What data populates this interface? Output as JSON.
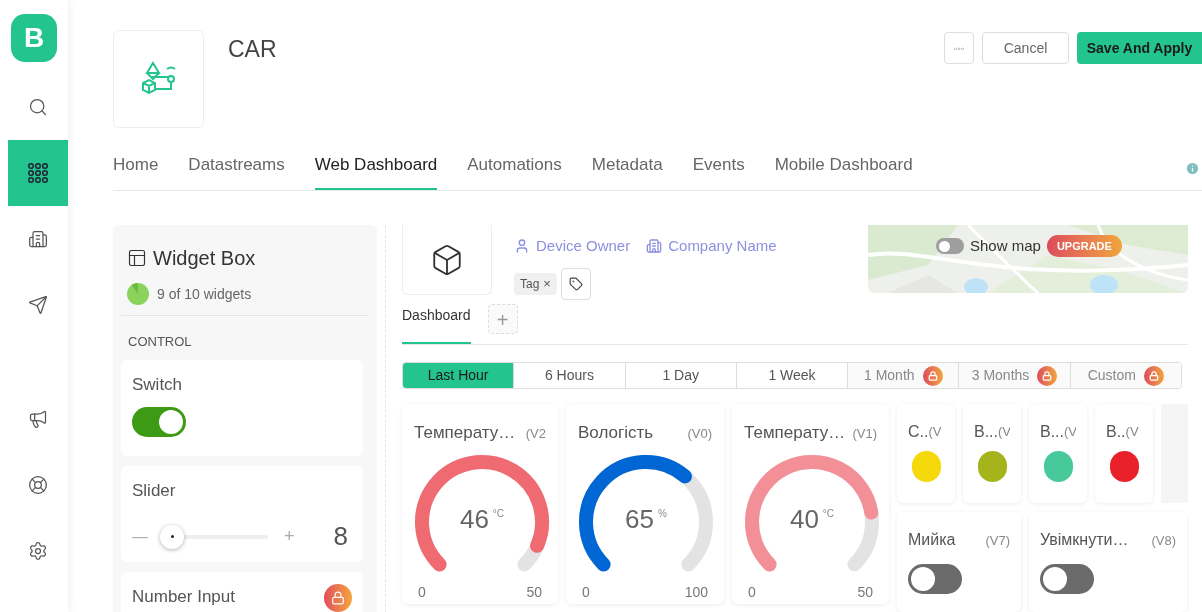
{
  "sidebar": {
    "logo": "B",
    "items": [
      {
        "selected": false
      },
      {
        "selected": true
      },
      {
        "selected": false
      },
      {
        "selected": false
      },
      {
        "selected": false
      },
      {
        "selected": false
      },
      {
        "selected": false
      }
    ]
  },
  "header": {
    "title": "CAR",
    "more_button": "◦◦◦",
    "cancel_button": "Cancel",
    "save_button": "Save And Apply"
  },
  "tabs": [
    {
      "label": "Home",
      "selected": false
    },
    {
      "label": "Datastreams",
      "selected": false
    },
    {
      "label": "Web Dashboard",
      "selected": true
    },
    {
      "label": "Automations",
      "selected": false
    },
    {
      "label": "Metadata",
      "selected": false
    },
    {
      "label": "Events",
      "selected": false
    },
    {
      "label": "Mobile Dashboard",
      "selected": false
    }
  ],
  "widget_box": {
    "title": "Widget Box",
    "count": "9 of 10 widgets",
    "section": "CONTROL",
    "widgets": [
      {
        "kind": "switch",
        "title": "Switch",
        "on": true
      },
      {
        "kind": "slider",
        "title": "Slider",
        "minus": "—",
        "plus": "+",
        "reading": "8"
      },
      {
        "kind": "locked",
        "title": "Number Input"
      }
    ]
  },
  "device": {
    "owner": "Device Owner",
    "company": "Company Name",
    "tags": [
      {
        "label": "Tag",
        "remove": "×"
      }
    ],
    "map": {
      "toggle_label": "Show map",
      "on": false,
      "badge": "UPGRADE"
    }
  },
  "dashboard_tabs": [
    {
      "label": "Dashboard",
      "selected": true
    }
  ],
  "add_tab": "+",
  "time_ranges": [
    {
      "label": "Last Hour",
      "selected": true,
      "locked": false
    },
    {
      "label": "6 Hours",
      "selected": false,
      "locked": false
    },
    {
      "label": "1 Day",
      "selected": false,
      "locked": false
    },
    {
      "label": "1 Week",
      "selected": false,
      "locked": false
    },
    {
      "label": "1 Month",
      "selected": false,
      "locked": true
    },
    {
      "label": "3 Months",
      "selected": false,
      "locked": true
    },
    {
      "label": "Custom",
      "selected": false,
      "locked": true
    }
  ],
  "gauges": [
    {
      "title": "Температу…",
      "pin": "(V2",
      "value": "46",
      "unit": "°C",
      "min": "0",
      "max": "50",
      "color": "#f06a72"
    },
    {
      "title": "Вологість",
      "pin": "(V0)",
      "value": "65",
      "unit": "%",
      "min": "0",
      "max": "100",
      "color": "#0066d4"
    },
    {
      "title": "Температу…",
      "pin": "(V1)",
      "value": "40",
      "unit": "°C",
      "min": "0",
      "max": "50",
      "color": "#f39097"
    }
  ],
  "leds": [
    {
      "title": "С..",
      "pin": "(V",
      "color": "#f5d90a"
    },
    {
      "title": "В...",
      "pin": "(V",
      "color": "#a4b41a"
    },
    {
      "title": "В...",
      "pin": "(V",
      "color": "#47c99b"
    },
    {
      "title": "В..",
      "pin": "(V",
      "color": "#e8212b"
    }
  ],
  "switches": [
    {
      "title": "Мийка",
      "pin": "(V7)",
      "on": false
    },
    {
      "title": "Увімкнути…",
      "pin": "(V8)",
      "on": false
    }
  ]
}
